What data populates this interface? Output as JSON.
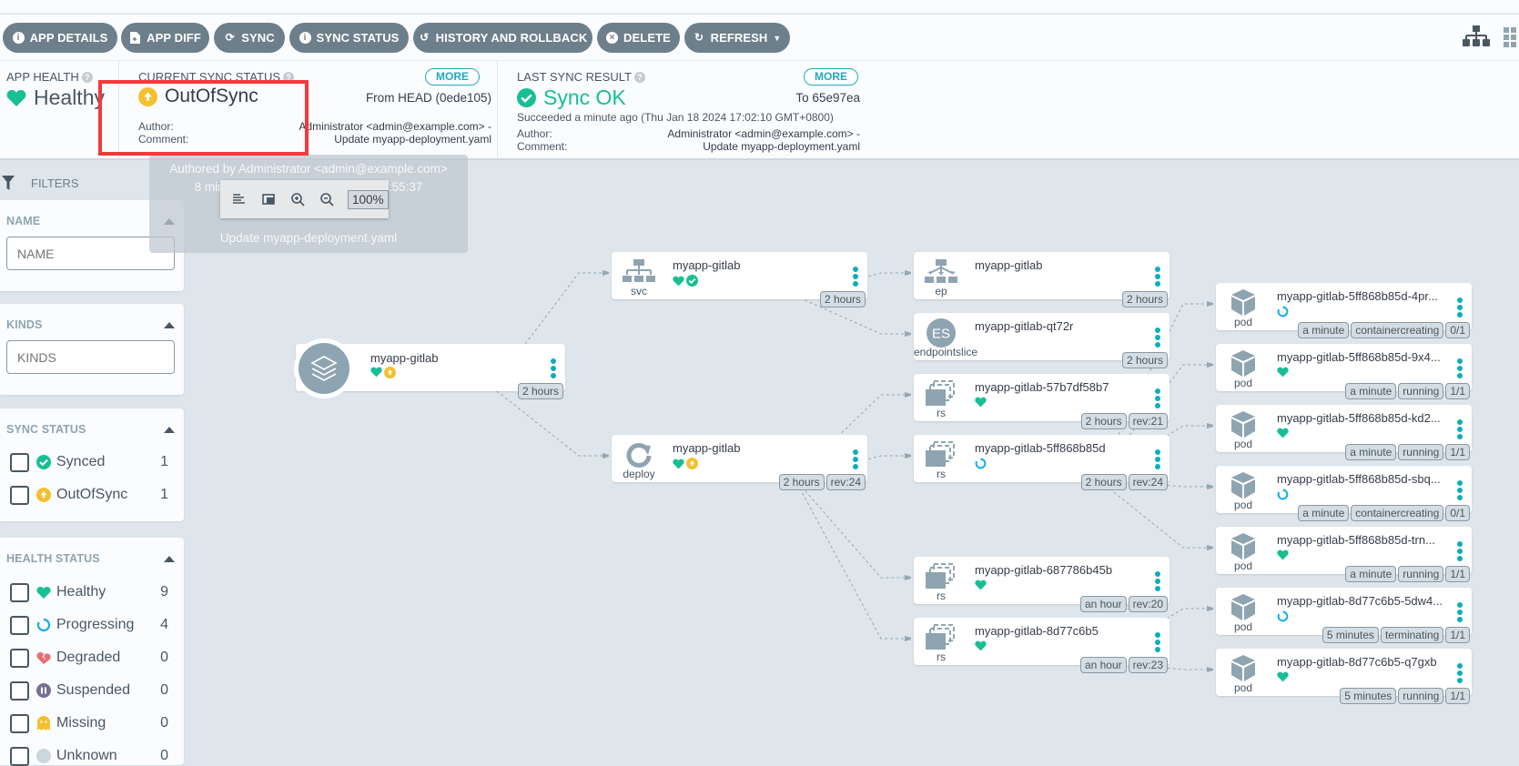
{
  "toolbar": {
    "buttons": [
      {
        "label": "APP DETAILS",
        "icon": "info-icon"
      },
      {
        "label": "APP DIFF",
        "icon": "file-diff-icon"
      },
      {
        "label": "SYNC",
        "icon": "sync-icon"
      },
      {
        "label": "SYNC STATUS",
        "icon": "info-icon"
      },
      {
        "label": "HISTORY AND ROLLBACK",
        "icon": "history-icon"
      },
      {
        "label": "DELETE",
        "icon": "times-circle-icon"
      },
      {
        "label": "REFRESH",
        "icon": "redo-icon",
        "dropdown": true
      }
    ],
    "view_icons": [
      "tree-view-icon",
      "grid-view-icon"
    ]
  },
  "header": {
    "app_health": {
      "label": "APP HEALTH",
      "status": "Healthy",
      "color": "#18be94"
    },
    "current_sync": {
      "label": "CURRENT SYNC STATUS",
      "status": "OutOfSync",
      "color": "#f4c030",
      "more_label": "MORE",
      "revision": "From HEAD (0ede105)",
      "author_label": "Author:",
      "author_value": "Administrator <admin@example.com> -",
      "comment_label": "Comment:",
      "comment_value": "Update myapp-deployment.yaml"
    },
    "last_sync": {
      "label": "LAST SYNC RESULT",
      "status": "Sync OK",
      "color": "#18be94",
      "more_label": "MORE",
      "revision": "To 65e97ea",
      "succeeded": "Succeeded a minute ago (Thu Jan 18 2024 17:02:10 GMT+0800)",
      "author_label": "Author:",
      "author_value": "Administrator <admin@example.com> -",
      "comment_label": "Comment:",
      "comment_value": "Update myapp-deployment.yaml"
    }
  },
  "tooltip": {
    "line1": "Authored by Administrator <admin@example.com>",
    "line2": "8 minutes ago (Thu Jan 18 2024 16:55:37",
    "line3": "GMT+0800)",
    "line4": "Update myapp-deployment.yaml"
  },
  "zoom": {
    "value": "100%"
  },
  "filters": {
    "title": "FILTERS",
    "name": {
      "title": "NAME",
      "placeholder": "NAME"
    },
    "kinds": {
      "title": "KINDS",
      "placeholder": "KINDS"
    },
    "sync_status": {
      "title": "SYNC STATUS",
      "items": [
        {
          "label": "Synced",
          "count": "1",
          "icon": "check-circle-icon",
          "color": "#18be94"
        },
        {
          "label": "OutOfSync",
          "count": "1",
          "icon": "arrow-up-circle-icon",
          "color": "#f4c030"
        }
      ]
    },
    "health_status": {
      "title": "HEALTH STATUS",
      "items": [
        {
          "label": "Healthy",
          "count": "9",
          "icon": "heart-icon",
          "color": "#18be94"
        },
        {
          "label": "Progressing",
          "count": "4",
          "icon": "progress-ring-icon",
          "color": "#0dadea"
        },
        {
          "label": "Degraded",
          "count": "0",
          "icon": "broken-heart-icon",
          "color": "#e96d76"
        },
        {
          "label": "Suspended",
          "count": "0",
          "icon": "pause-circle-icon",
          "color": "#766f94"
        },
        {
          "label": "Missing",
          "count": "0",
          "icon": "ghost-icon",
          "color": "#f4c030"
        },
        {
          "label": "Unknown",
          "count": "0",
          "icon": "question-circle-icon",
          "color": "#ccd6dd"
        }
      ]
    }
  },
  "graph": {
    "app": {
      "name": "myapp-gitlab",
      "health": "healthy",
      "sync": "outofsync",
      "tags": [
        "2 hours"
      ]
    },
    "nodes": [
      {
        "id": "svc",
        "kind": "svc",
        "name": "myapp-gitlab",
        "health": "healthy",
        "sync": "synced",
        "tags": [
          "2 hours"
        ]
      },
      {
        "id": "deploy",
        "kind": "deploy",
        "name": "myapp-gitlab",
        "health": "healthy",
        "sync": "outofsync",
        "tags": [
          "2 hours",
          "rev:24"
        ]
      },
      {
        "id": "ep",
        "kind": "ep",
        "name": "myapp-gitlab",
        "health": "",
        "sync": "",
        "tags": [
          "2 hours"
        ]
      },
      {
        "id": "es",
        "kind": "endpointslice",
        "name": "myapp-gitlab-qt72r",
        "health": "",
        "sync": "",
        "tags": [
          "2 hours"
        ]
      },
      {
        "id": "rs1",
        "kind": "rs",
        "name": "myapp-gitlab-57b7df58b7",
        "health": "healthy",
        "sync": "",
        "tags": [
          "2 hours",
          "rev:21"
        ]
      },
      {
        "id": "rs2",
        "kind": "rs",
        "name": "myapp-gitlab-5ff868b85d",
        "health": "progressing",
        "sync": "",
        "tags": [
          "2 hours",
          "rev:24"
        ]
      },
      {
        "id": "rs3",
        "kind": "rs",
        "name": "myapp-gitlab-687786b45b",
        "health": "healthy",
        "sync": "",
        "tags": [
          "an hour",
          "rev:20"
        ]
      },
      {
        "id": "rs4",
        "kind": "rs",
        "name": "myapp-gitlab-8d77c6b5",
        "health": "healthy",
        "sync": "",
        "tags": [
          "an hour",
          "rev:23"
        ]
      },
      {
        "id": "pod1",
        "kind": "pod",
        "name": "myapp-gitlab-5ff868b85d-4pr...",
        "health": "progressing",
        "sync": "",
        "tags": [
          "a minute",
          "containercreating",
          "0/1"
        ]
      },
      {
        "id": "pod2",
        "kind": "pod",
        "name": "myapp-gitlab-5ff868b85d-9x4...",
        "health": "healthy",
        "sync": "",
        "tags": [
          "a minute",
          "running",
          "1/1"
        ]
      },
      {
        "id": "pod3",
        "kind": "pod",
        "name": "myapp-gitlab-5ff868b85d-kd2...",
        "health": "healthy",
        "sync": "",
        "tags": [
          "a minute",
          "running",
          "1/1"
        ]
      },
      {
        "id": "pod4",
        "kind": "pod",
        "name": "myapp-gitlab-5ff868b85d-sbq...",
        "health": "progressing",
        "sync": "",
        "tags": [
          "a minute",
          "containercreating",
          "0/1"
        ]
      },
      {
        "id": "pod5",
        "kind": "pod",
        "name": "myapp-gitlab-5ff868b85d-trn...",
        "health": "healthy",
        "sync": "",
        "tags": [
          "a minute",
          "running",
          "1/1"
        ]
      },
      {
        "id": "pod6",
        "kind": "pod",
        "name": "myapp-gitlab-8d77c6b5-5dw4...",
        "health": "progressing",
        "sync": "",
        "tags": [
          "5 minutes",
          "terminating",
          "1/1"
        ]
      },
      {
        "id": "pod7",
        "kind": "pod",
        "name": "myapp-gitlab-8d77c6b5-q7gxb",
        "health": "healthy",
        "sync": "",
        "tags": [
          "5 minutes",
          "running",
          "1/1"
        ]
      }
    ],
    "edges": [
      [
        "app",
        "svc"
      ],
      [
        "app",
        "deploy"
      ],
      [
        "svc",
        "ep"
      ],
      [
        "svc",
        "es"
      ],
      [
        "deploy",
        "rs1"
      ],
      [
        "deploy",
        "rs2"
      ],
      [
        "deploy",
        "rs3"
      ],
      [
        "deploy",
        "rs4"
      ],
      [
        "rs2",
        "pod1"
      ],
      [
        "rs2",
        "pod2"
      ],
      [
        "rs2",
        "pod3"
      ],
      [
        "rs2",
        "pod4"
      ],
      [
        "rs2",
        "pod5"
      ],
      [
        "rs4",
        "pod6"
      ],
      [
        "rs4",
        "pod7"
      ]
    ]
  }
}
